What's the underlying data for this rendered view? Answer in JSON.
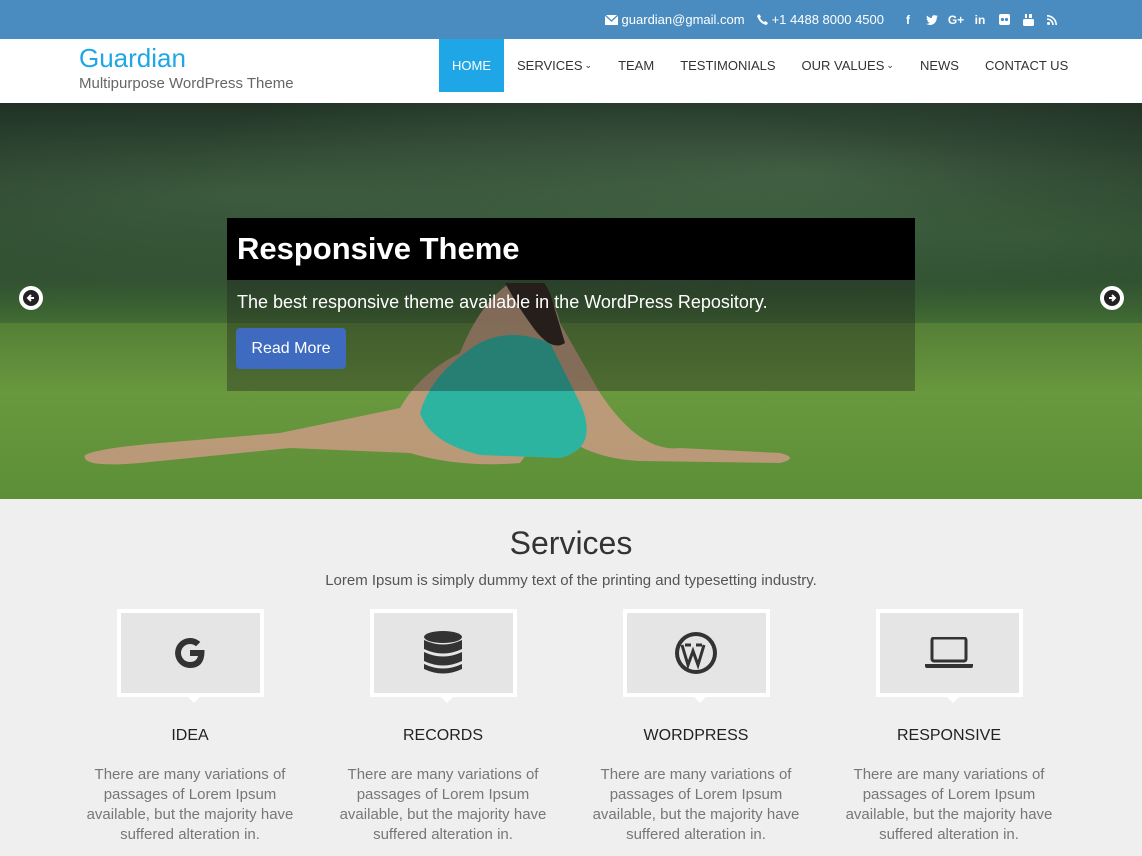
{
  "topbar": {
    "email": "guardian@gmail.com",
    "phone": "+1 4488 8000 4500",
    "social": [
      "facebook-icon",
      "twitter-icon",
      "google-plus-icon",
      "linkedin-icon",
      "flickr-icon",
      "youtube-icon",
      "rss-icon"
    ],
    "social_labels": {
      "facebook": "f",
      "google": "G+",
      "linkedin": "in"
    }
  },
  "header": {
    "title": "Guardian",
    "tagline": "Multipurpose WordPress Theme"
  },
  "nav": {
    "home": "HOME",
    "services": "SERVICES",
    "team": "TEAM",
    "testimonials": "TESTIMONIALS",
    "our_values": "OUR VALUES",
    "news": "NEWS",
    "contact": "CONTACT US"
  },
  "hero": {
    "heading": "Responsive Theme",
    "description": "The best responsive theme available in the WordPress Repository.",
    "button": "Read More"
  },
  "services": {
    "title": "Services",
    "subtitle": "Lorem Ipsum is simply dummy text of the printing and typesetting industry.",
    "items": [
      {
        "name": "IDEA",
        "icon": "google-icon",
        "text": "There are many variations of passages of Lorem Ipsum available, but the majority have suffered alteration in."
      },
      {
        "name": "RECORDS",
        "icon": "database-icon",
        "text": "There are many variations of passages of Lorem Ipsum available, but the majority have suffered alteration in."
      },
      {
        "name": "WORDPRESS",
        "icon": "wordpress-icon",
        "text": "There are many variations of passages of Lorem Ipsum available, but the majority have suffered alteration in."
      },
      {
        "name": "RESPONSIVE",
        "icon": "laptop-icon",
        "text": "There are many variations of passages of Lorem Ipsum available, but the majority have suffered alteration in."
      }
    ]
  },
  "colors": {
    "topbar": "#4a8cc0",
    "accent": "#1ea6e6",
    "button": "#3e6bbf"
  }
}
